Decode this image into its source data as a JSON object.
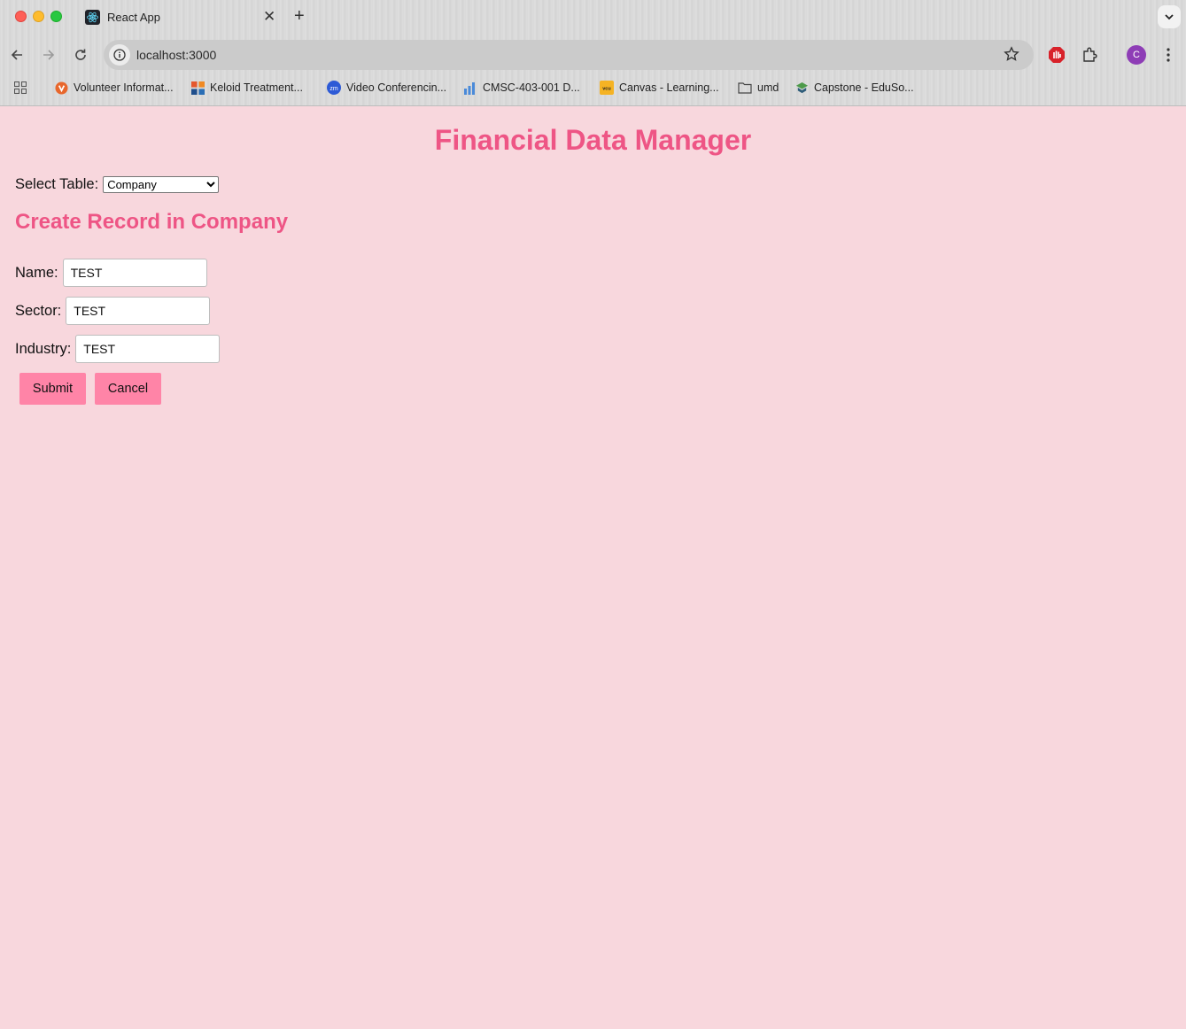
{
  "browser": {
    "tab_title": "React App",
    "url": "localhost:3000",
    "profile_initial": "C",
    "bookmarks": [
      {
        "label": "Volunteer Informat...",
        "icon": "v-circle-icon"
      },
      {
        "label": "Keloid Treatment...",
        "icon": "grid-color-icon"
      },
      {
        "label": "Video Conferencin...",
        "icon": "zoom-icon"
      },
      {
        "label": "CMSC-403-001 D...",
        "icon": "bar-chart-icon"
      },
      {
        "label": "Canvas - Learning...",
        "icon": "vcu-icon"
      },
      {
        "label": "umd",
        "icon": "folder-icon"
      },
      {
        "label": "Capstone - EduSo...",
        "icon": "edusource-icon"
      }
    ]
  },
  "app": {
    "title": "Financial Data Manager",
    "select_label": "Select Table:",
    "selected_table": "Company",
    "section_title": "Create Record in Company",
    "fields": [
      {
        "label": "Name:",
        "value": "TEST"
      },
      {
        "label": "Sector:",
        "value": "TEST"
      },
      {
        "label": "Industry:",
        "value": "TEST"
      }
    ],
    "submit_label": "Submit",
    "cancel_label": "Cancel"
  },
  "colors": {
    "page_background": "#f8d7dd",
    "heading": "#ee5585",
    "button": "#ff84a7"
  }
}
